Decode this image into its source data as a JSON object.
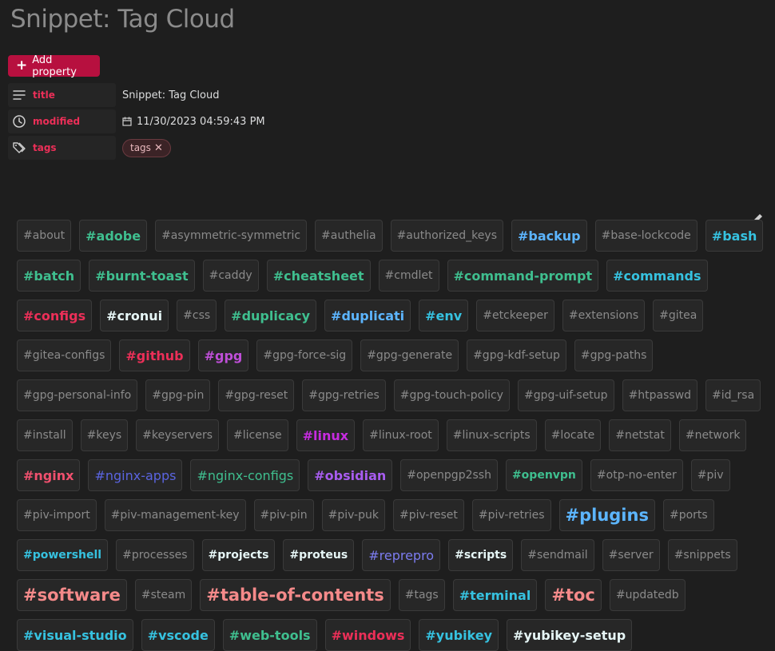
{
  "page": {
    "title": "Snippet: Tag Cloud"
  },
  "add_property": {
    "label": "Add property",
    "icon": "plus-icon"
  },
  "properties": {
    "title": {
      "key": "title",
      "icon": "text-lines-icon",
      "value": "Snippet: Tag Cloud"
    },
    "modified": {
      "key": "modified",
      "icon": "clock-icon",
      "value_icon": "calendar-icon",
      "value": "11/30/2023 04:59:43 PM"
    },
    "tags": {
      "key": "tags",
      "icon": "tags-icon",
      "pill": "tags",
      "remove_icon": "close-icon"
    }
  },
  "colors": {
    "accent": "#b7103f",
    "key_text": "#ec2f58",
    "tag_default": "#8a8a8a"
  },
  "tags": [
    {
      "text": "#about",
      "color": "#8a8a8a",
      "style": ""
    },
    {
      "text": "#adobe",
      "color": "#3fbf8f",
      "style": "b l"
    },
    {
      "text": "#asymmetric-symmetric",
      "color": "#8a8a8a",
      "style": ""
    },
    {
      "text": "#authelia",
      "color": "#8a8a8a",
      "style": ""
    },
    {
      "text": "#authorized_keys",
      "color": "#8a8a8a",
      "style": ""
    },
    {
      "text": "#backup",
      "color": "#5cb5ff",
      "style": "b l"
    },
    {
      "text": "#base-lockcode",
      "color": "#8a8a8a",
      "style": ""
    },
    {
      "text": "#bash",
      "color": "#36c2e0",
      "style": "b l"
    },
    {
      "text": "#batch",
      "color": "#3fbf8f",
      "style": "b l"
    },
    {
      "text": "#burnt-toast",
      "color": "#3fbf8f",
      "style": "b l"
    },
    {
      "text": "#caddy",
      "color": "#8a8a8a",
      "style": ""
    },
    {
      "text": "#cheatsheet",
      "color": "#3fbf8f",
      "style": "b l"
    },
    {
      "text": "#cmdlet",
      "color": "#8a8a8a",
      "style": ""
    },
    {
      "text": "#command-prompt",
      "color": "#3fbf8f",
      "style": "b l"
    },
    {
      "text": "#commands",
      "color": "#36c2e0",
      "style": "b l"
    },
    {
      "text": "#configs",
      "color": "#ec2f58",
      "style": "b l"
    },
    {
      "text": "#cronui",
      "color": "#e6f6f6",
      "style": "b l"
    },
    {
      "text": "#css",
      "color": "#8a8a8a",
      "style": ""
    },
    {
      "text": "#duplicacy",
      "color": "#3fbf8f",
      "style": "b l"
    },
    {
      "text": "#duplicati",
      "color": "#5cb5ff",
      "style": "b l"
    },
    {
      "text": "#env",
      "color": "#36c2e0",
      "style": "b l"
    },
    {
      "text": "#etckeeper",
      "color": "#8a8a8a",
      "style": ""
    },
    {
      "text": "#extensions",
      "color": "#8a8a8a",
      "style": ""
    },
    {
      "text": "#gitea",
      "color": "#8a8a8a",
      "style": ""
    },
    {
      "text": "#gitea-configs",
      "color": "#8a8a8a",
      "style": ""
    },
    {
      "text": "#github",
      "color": "#ec2f58",
      "style": "b l"
    },
    {
      "text": "#gpg",
      "color": "#c04fd9",
      "style": "b l"
    },
    {
      "text": "#gpg-force-sig",
      "color": "#8a8a8a",
      "style": ""
    },
    {
      "text": "#gpg-generate",
      "color": "#8a8a8a",
      "style": ""
    },
    {
      "text": "#gpg-kdf-setup",
      "color": "#8a8a8a",
      "style": ""
    },
    {
      "text": "#gpg-paths",
      "color": "#8a8a8a",
      "style": ""
    },
    {
      "text": "#gpg-personal-info",
      "color": "#8a8a8a",
      "style": ""
    },
    {
      "text": "#gpg-pin",
      "color": "#8a8a8a",
      "style": ""
    },
    {
      "text": "#gpg-reset",
      "color": "#8a8a8a",
      "style": ""
    },
    {
      "text": "#gpg-retries",
      "color": "#8a8a8a",
      "style": ""
    },
    {
      "text": "#gpg-touch-policy",
      "color": "#8a8a8a",
      "style": ""
    },
    {
      "text": "#gpg-uif-setup",
      "color": "#8a8a8a",
      "style": ""
    },
    {
      "text": "#htpasswd",
      "color": "#8a8a8a",
      "style": ""
    },
    {
      "text": "#id_rsa",
      "color": "#8a8a8a",
      "style": ""
    },
    {
      "text": "#install",
      "color": "#8a8a8a",
      "style": ""
    },
    {
      "text": "#keys",
      "color": "#8a8a8a",
      "style": ""
    },
    {
      "text": "#keyservers",
      "color": "#8a8a8a",
      "style": ""
    },
    {
      "text": "#license",
      "color": "#8a8a8a",
      "style": ""
    },
    {
      "text": "#linux",
      "color": "#c72be0",
      "style": "b l"
    },
    {
      "text": "#linux-root",
      "color": "#8a8a8a",
      "style": ""
    },
    {
      "text": "#linux-scripts",
      "color": "#8a8a8a",
      "style": ""
    },
    {
      "text": "#locate",
      "color": "#8a8a8a",
      "style": ""
    },
    {
      "text": "#netstat",
      "color": "#8a8a8a",
      "style": ""
    },
    {
      "text": "#network",
      "color": "#8a8a8a",
      "style": ""
    },
    {
      "text": "#nginx",
      "color": "#f0506e",
      "style": "b l"
    },
    {
      "text": "#nginx-apps",
      "color": "#5a64e0",
      "style": "l"
    },
    {
      "text": "#nginx-configs",
      "color": "#3fbf8f",
      "style": "l"
    },
    {
      "text": "#obsidian",
      "color": "#a85cf0",
      "style": "b l"
    },
    {
      "text": "#openpgp2ssh",
      "color": "#8a8a8a",
      "style": ""
    },
    {
      "text": "#openvpn",
      "color": "#3fbf8f",
      "style": "b"
    },
    {
      "text": "#otp-no-enter",
      "color": "#8a8a8a",
      "style": ""
    },
    {
      "text": "#piv",
      "color": "#8a8a8a",
      "style": ""
    },
    {
      "text": "#piv-import",
      "color": "#8a8a8a",
      "style": ""
    },
    {
      "text": "#piv-management-key",
      "color": "#8a8a8a",
      "style": ""
    },
    {
      "text": "#piv-pin",
      "color": "#8a8a8a",
      "style": ""
    },
    {
      "text": "#piv-puk",
      "color": "#8a8a8a",
      "style": ""
    },
    {
      "text": "#piv-reset",
      "color": "#8a8a8a",
      "style": ""
    },
    {
      "text": "#piv-retries",
      "color": "#8a8a8a",
      "style": ""
    },
    {
      "text": "#plugins",
      "color": "#5cb5ff",
      "style": "b xl"
    },
    {
      "text": "#ports",
      "color": "#8a8a8a",
      "style": ""
    },
    {
      "text": "#powershell",
      "color": "#36c2e0",
      "style": "b"
    },
    {
      "text": "#processes",
      "color": "#8a8a8a",
      "style": ""
    },
    {
      "text": "#projects",
      "color": "#e6f6f6",
      "style": "b"
    },
    {
      "text": "#proteus",
      "color": "#e6f6f6",
      "style": "b"
    },
    {
      "text": "#reprepro",
      "color": "#7c7cf0",
      "style": "l"
    },
    {
      "text": "#scripts",
      "color": "#e6f6f6",
      "style": "b"
    },
    {
      "text": "#sendmail",
      "color": "#8a8a8a",
      "style": ""
    },
    {
      "text": "#server",
      "color": "#8a8a8a",
      "style": ""
    },
    {
      "text": "#snippets",
      "color": "#8a8a8a",
      "style": ""
    },
    {
      "text": "#software",
      "color": "#f58a8a",
      "style": "b xl"
    },
    {
      "text": "#steam",
      "color": "#8a8a8a",
      "style": ""
    },
    {
      "text": "#table-of-contents",
      "color": "#f58a8a",
      "style": "b xl"
    },
    {
      "text": "#tags",
      "color": "#8a8a8a",
      "style": ""
    },
    {
      "text": "#terminal",
      "color": "#36c2e0",
      "style": "b l"
    },
    {
      "text": "#toc",
      "color": "#f58a8a",
      "style": "b xl"
    },
    {
      "text": "#updatedb",
      "color": "#8a8a8a",
      "style": ""
    },
    {
      "text": "#visual-studio",
      "color": "#36c2e0",
      "style": "b l"
    },
    {
      "text": "#vscode",
      "color": "#36c2e0",
      "style": "b l"
    },
    {
      "text": "#web-tools",
      "color": "#3fbf8f",
      "style": "b l"
    },
    {
      "text": "#windows",
      "color": "#ec2f58",
      "style": "b l"
    },
    {
      "text": "#yubikey",
      "color": "#36c2e0",
      "style": "b l"
    },
    {
      "text": "#yubikey-setup",
      "color": "#e6f6f6",
      "style": "b l"
    }
  ]
}
